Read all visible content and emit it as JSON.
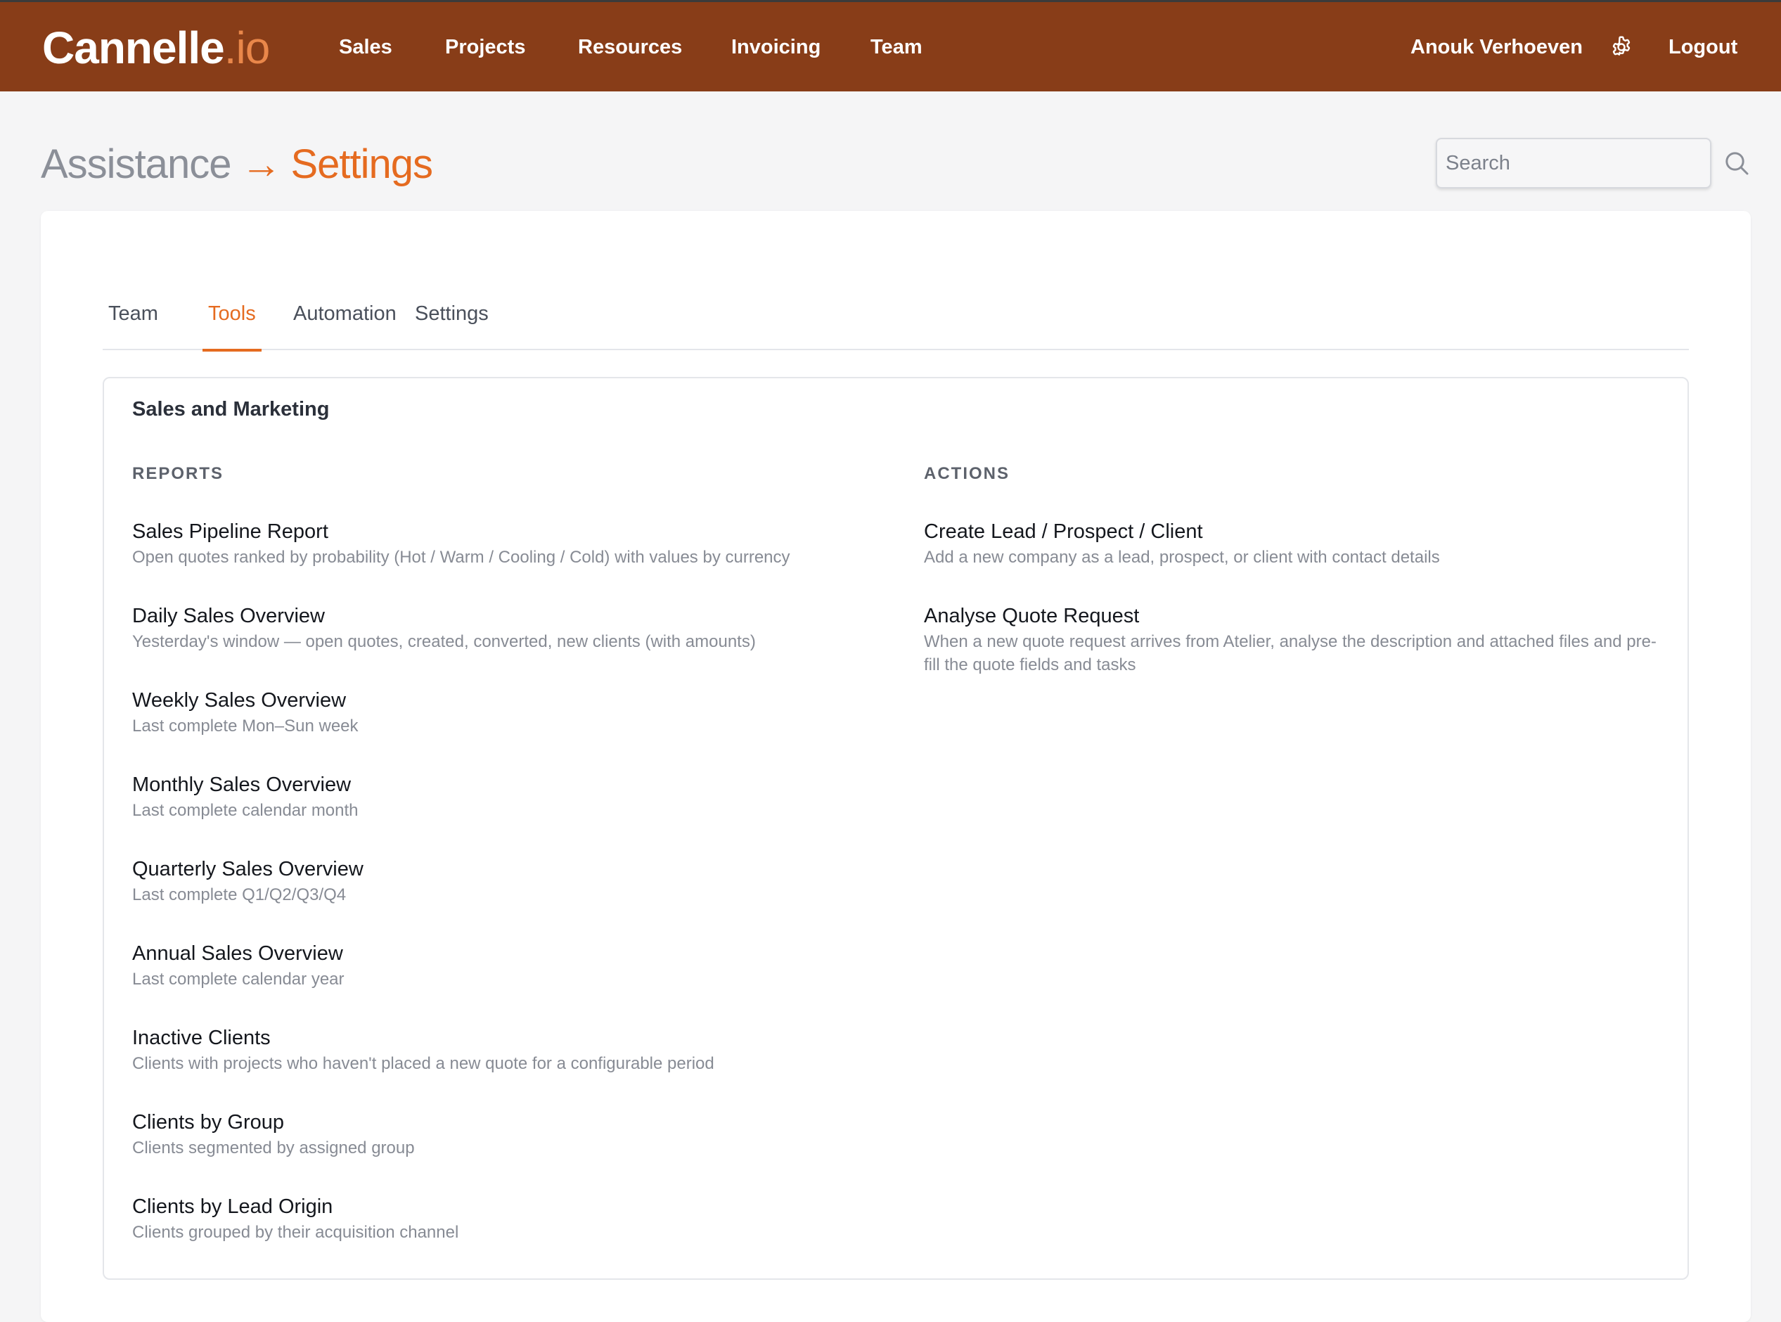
{
  "brand": {
    "name": "Cannelle",
    "tld": ".io"
  },
  "nav": [
    "Sales",
    "Projects",
    "Resources",
    "Invoicing",
    "Team"
  ],
  "user": {
    "name": "Anouk Verhoeven",
    "settings_icon": "gear-icon",
    "logout_label": "Logout"
  },
  "breadcrumb": {
    "root": "Assistance",
    "separator": "→",
    "current": "Settings"
  },
  "search": {
    "placeholder": "Search",
    "value": "",
    "icon": "search-icon"
  },
  "tabs": [
    {
      "label": "Team",
      "active": false
    },
    {
      "label": "Tools",
      "active": true
    },
    {
      "label": "Automation",
      "active": false
    },
    {
      "label": "Settings",
      "active": false
    }
  ],
  "section": {
    "title": "Sales and Marketing",
    "reports_heading": "REPORTS",
    "actions_heading": "ACTIONS",
    "reports": [
      {
        "title": "Sales Pipeline Report",
        "description": "Open quotes ranked by probability (Hot / Warm / Cooling / Cold) with values by currency"
      },
      {
        "title": "Daily Sales Overview",
        "description": "Yesterday's window — open quotes, created, converted, new clients (with amounts)"
      },
      {
        "title": "Weekly Sales Overview",
        "description": "Last complete Mon–Sun week"
      },
      {
        "title": "Monthly Sales Overview",
        "description": "Last complete calendar month"
      },
      {
        "title": "Quarterly Sales Overview",
        "description": "Last complete Q1/Q2/Q3/Q4"
      },
      {
        "title": "Annual Sales Overview",
        "description": "Last complete calendar year"
      },
      {
        "title": "Inactive Clients",
        "description": "Clients with projects who haven't placed a new quote for a configurable period"
      },
      {
        "title": "Clients by Group",
        "description": "Clients segmented by assigned group"
      },
      {
        "title": "Clients by Lead Origin",
        "description": "Clients grouped by their acquisition channel"
      }
    ],
    "actions": [
      {
        "title": "Create Lead / Prospect / Client",
        "description": "Add a new company as a lead, prospect, or client with contact details"
      },
      {
        "title": "Analyse Quote Request",
        "description": "When a new quote request arrives from Atelier, analyse the description and attached files and pre-fill the quote fields and tasks"
      }
    ]
  }
}
